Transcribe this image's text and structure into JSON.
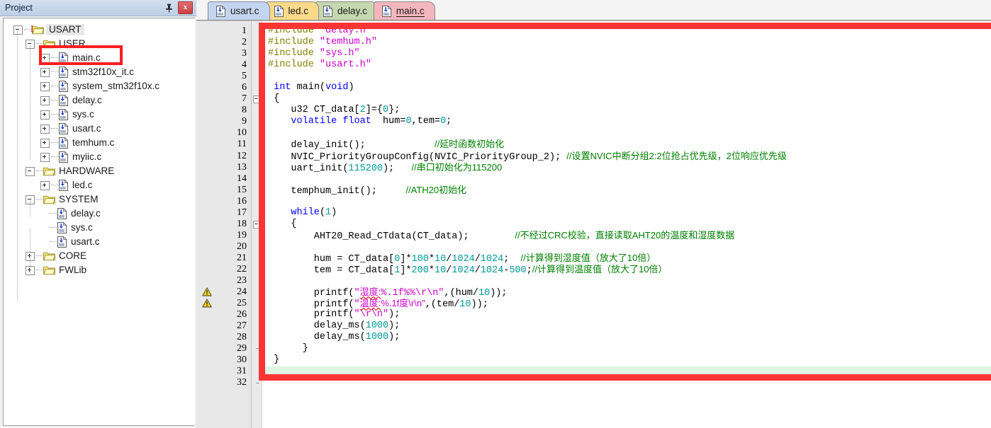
{
  "project_panel": {
    "title": "Project",
    "pin_icon": "pin-icon",
    "close_label": "x",
    "tree": [
      {
        "label": "USART",
        "depth": 0,
        "type": "project",
        "expander": "minus",
        "selected": true
      },
      {
        "label": "USER",
        "depth": 1,
        "type": "folder",
        "expander": "minus",
        "selected": false
      },
      {
        "label": "main.c",
        "depth": 2,
        "type": "cfile",
        "expander": "plus",
        "selected": false,
        "highlighted": true
      },
      {
        "label": "stm32f10x_it.c",
        "depth": 2,
        "type": "cfile",
        "expander": "plus",
        "selected": false
      },
      {
        "label": "system_stm32f10x.c",
        "depth": 2,
        "type": "cfile",
        "expander": "plus",
        "selected": false
      },
      {
        "label": "delay.c",
        "depth": 2,
        "type": "cfile",
        "expander": "plus",
        "selected": false
      },
      {
        "label": "sys.c",
        "depth": 2,
        "type": "cfile",
        "expander": "plus",
        "selected": false
      },
      {
        "label": "usart.c",
        "depth": 2,
        "type": "cfile",
        "expander": "plus",
        "selected": false
      },
      {
        "label": "temhum.c",
        "depth": 2,
        "type": "cfile",
        "expander": "plus",
        "selected": false
      },
      {
        "label": "myiic.c",
        "depth": 2,
        "type": "cfile",
        "expander": "plus",
        "selected": false
      },
      {
        "label": "HARDWARE",
        "depth": 1,
        "type": "folder",
        "expander": "minus",
        "selected": false
      },
      {
        "label": "led.c",
        "depth": 2,
        "type": "cfile",
        "expander": "plus",
        "selected": false
      },
      {
        "label": "SYSTEM",
        "depth": 1,
        "type": "folder",
        "expander": "minus",
        "selected": false
      },
      {
        "label": "delay.c",
        "depth": 2,
        "type": "cfile",
        "expander": "none",
        "selected": false
      },
      {
        "label": "sys.c",
        "depth": 2,
        "type": "cfile",
        "expander": "none",
        "selected": false
      },
      {
        "label": "usart.c",
        "depth": 2,
        "type": "cfile",
        "expander": "none",
        "selected": false
      },
      {
        "label": "CORE",
        "depth": 1,
        "type": "folder",
        "expander": "plus",
        "selected": false
      },
      {
        "label": "FWLib",
        "depth": 1,
        "type": "folder",
        "expander": "plus",
        "selected": false
      }
    ]
  },
  "editor": {
    "tabs": [
      {
        "label": "usart.c",
        "color": "#c4d5ef",
        "active": false
      },
      {
        "label": "led.c",
        "color": "#fbd98a",
        "active": false
      },
      {
        "label": "delay.c",
        "color": "#c6d8b0",
        "active": false
      },
      {
        "label": "main.c",
        "color": "#f3b6bd",
        "active": true
      }
    ],
    "line_numbers": [
      1,
      2,
      3,
      4,
      5,
      6,
      7,
      8,
      9,
      10,
      11,
      12,
      13,
      14,
      15,
      16,
      17,
      18,
      19,
      20,
      21,
      22,
      23,
      24,
      25,
      26,
      27,
      28,
      29,
      30,
      31,
      32
    ],
    "warning_lines": [
      24,
      25
    ],
    "highlight_line": 31,
    "highlight_color": "#ddf7e3",
    "annotation_color": "#fb3434",
    "code_lines": [
      {
        "n": 1,
        "tokens": [
          {
            "t": "#include ",
            "c": "pp"
          },
          {
            "t": "\"delay.h\"",
            "c": "str"
          }
        ]
      },
      {
        "n": 2,
        "tokens": [
          {
            "t": "#include ",
            "c": "pp"
          },
          {
            "t": "\"temhum.h\"",
            "c": "str"
          }
        ]
      },
      {
        "n": 3,
        "tokens": [
          {
            "t": "#include ",
            "c": "pp"
          },
          {
            "t": "\"sys.h\"",
            "c": "str"
          }
        ]
      },
      {
        "n": 4,
        "tokens": [
          {
            "t": "#include ",
            "c": "pp"
          },
          {
            "t": "\"usart.h\"",
            "c": "str"
          }
        ]
      },
      {
        "n": 5,
        "tokens": []
      },
      {
        "n": 6,
        "tokens": [
          {
            "t": " ",
            "c": ""
          },
          {
            "t": "int",
            "c": "k"
          },
          {
            "t": " main(",
            "c": ""
          },
          {
            "t": "void",
            "c": "k"
          },
          {
            "t": ")",
            "c": ""
          }
        ]
      },
      {
        "n": 7,
        "tokens": [
          {
            "t": " {",
            "c": ""
          }
        ]
      },
      {
        "n": 8,
        "tokens": [
          {
            "t": "    u32 CT_data[",
            "c": ""
          },
          {
            "t": "2",
            "c": "num"
          },
          {
            "t": "]={",
            "c": ""
          },
          {
            "t": "0",
            "c": "num"
          },
          {
            "t": "};",
            "c": ""
          }
        ]
      },
      {
        "n": 9,
        "tokens": [
          {
            "t": "    ",
            "c": ""
          },
          {
            "t": "volatile float",
            "c": "k"
          },
          {
            "t": "  hum=",
            "c": ""
          },
          {
            "t": "0",
            "c": "num"
          },
          {
            "t": ",tem=",
            "c": ""
          },
          {
            "t": "0",
            "c": "num"
          },
          {
            "t": ";",
            "c": ""
          }
        ]
      },
      {
        "n": 10,
        "tokens": []
      },
      {
        "n": 11,
        "tokens": [
          {
            "t": "    delay_init();            ",
            "c": ""
          },
          {
            "t": "//延时函数初始化",
            "c": "cm"
          }
        ]
      },
      {
        "n": 12,
        "tokens": [
          {
            "t": "    NVIC_PriorityGroupConfig(NVIC_PriorityGroup_2); ",
            "c": ""
          },
          {
            "t": "//设置NVIC中断分组2:2位抢占优先级，2位响应优先级",
            "c": "cm"
          }
        ]
      },
      {
        "n": 13,
        "tokens": [
          {
            "t": "    uart_init(",
            "c": ""
          },
          {
            "t": "115200",
            "c": "num"
          },
          {
            "t": ");   ",
            "c": ""
          },
          {
            "t": "//串口初始化为115200",
            "c": "cm"
          }
        ]
      },
      {
        "n": 14,
        "tokens": []
      },
      {
        "n": 15,
        "tokens": [
          {
            "t": "    temphum_init();     ",
            "c": ""
          },
          {
            "t": "//ATH20初始化",
            "c": "cm"
          }
        ]
      },
      {
        "n": 16,
        "tokens": []
      },
      {
        "n": 17,
        "tokens": [
          {
            "t": "    ",
            "c": ""
          },
          {
            "t": "while",
            "c": "k"
          },
          {
            "t": "(",
            "c": ""
          },
          {
            "t": "1",
            "c": "num"
          },
          {
            "t": ")",
            "c": ""
          }
        ]
      },
      {
        "n": 18,
        "tokens": [
          {
            "t": "    {",
            "c": ""
          }
        ]
      },
      {
        "n": 19,
        "tokens": [
          {
            "t": "        AHT20_Read_CTdata(CT_data);        ",
            "c": ""
          },
          {
            "t": "//不经过CRC校验，直接读取AHT20的温度和湿度数据",
            "c": "cm"
          }
        ]
      },
      {
        "n": 20,
        "tokens": []
      },
      {
        "n": 21,
        "tokens": [
          {
            "t": "        hum = CT_data[",
            "c": ""
          },
          {
            "t": "0",
            "c": "num"
          },
          {
            "t": "]*",
            "c": ""
          },
          {
            "t": "100",
            "c": "num"
          },
          {
            "t": "*",
            "c": ""
          },
          {
            "t": "10",
            "c": "num"
          },
          {
            "t": "/",
            "c": ""
          },
          {
            "t": "1024",
            "c": "num"
          },
          {
            "t": "/",
            "c": ""
          },
          {
            "t": "1024",
            "c": "num"
          },
          {
            "t": ";  ",
            "c": ""
          },
          {
            "t": "//计算得到湿度值（放大了10倍）",
            "c": "cm"
          }
        ]
      },
      {
        "n": 22,
        "tokens": [
          {
            "t": "        tem = CT_data[",
            "c": ""
          },
          {
            "t": "1",
            "c": "num"
          },
          {
            "t": "]*",
            "c": ""
          },
          {
            "t": "200",
            "c": "num"
          },
          {
            "t": "*",
            "c": ""
          },
          {
            "t": "10",
            "c": "num"
          },
          {
            "t": "/",
            "c": ""
          },
          {
            "t": "1024",
            "c": "num"
          },
          {
            "t": "/",
            "c": ""
          },
          {
            "t": "1024",
            "c": "num"
          },
          {
            "t": "-",
            "c": ""
          },
          {
            "t": "500",
            "c": "num"
          },
          {
            "t": ";",
            "c": ""
          },
          {
            "t": "//计算得到温度值（放大了10倍）",
            "c": "cm"
          }
        ]
      },
      {
        "n": 23,
        "tokens": []
      },
      {
        "n": 24,
        "tokens": [
          {
            "t": "        printf(",
            "c": ""
          },
          {
            "t": "\"",
            "c": "str"
          },
          {
            "t": "湿度:",
            "c": "str sq"
          },
          {
            "t": "%.1f%%\\r\\n\"",
            "c": "str"
          },
          {
            "t": ",(hum/",
            "c": ""
          },
          {
            "t": "10",
            "c": "num"
          },
          {
            "t": "));",
            "c": ""
          }
        ]
      },
      {
        "n": 25,
        "tokens": [
          {
            "t": "        printf(",
            "c": ""
          },
          {
            "t": "\"",
            "c": "str"
          },
          {
            "t": "温度:",
            "c": "str sq"
          },
          {
            "t": "%.1f度\\r\\n\"",
            "c": "str"
          },
          {
            "t": ",(tem/",
            "c": ""
          },
          {
            "t": "10",
            "c": "num"
          },
          {
            "t": "));",
            "c": ""
          }
        ]
      },
      {
        "n": 26,
        "tokens": [
          {
            "t": "        printf(",
            "c": ""
          },
          {
            "t": "\"\\r\\n\"",
            "c": "str"
          },
          {
            "t": ");",
            "c": ""
          }
        ]
      },
      {
        "n": 27,
        "tokens": [
          {
            "t": "        delay_ms(",
            "c": ""
          },
          {
            "t": "1000",
            "c": "num"
          },
          {
            "t": ");",
            "c": ""
          }
        ]
      },
      {
        "n": 28,
        "tokens": [
          {
            "t": "        delay_ms(",
            "c": ""
          },
          {
            "t": "1000",
            "c": "num"
          },
          {
            "t": ");",
            "c": ""
          }
        ]
      },
      {
        "n": 29,
        "tokens": [
          {
            "t": "      }",
            "c": ""
          }
        ]
      },
      {
        "n": 30,
        "tokens": [
          {
            "t": " }",
            "c": ""
          }
        ]
      },
      {
        "n": 31,
        "tokens": []
      },
      {
        "n": 32,
        "tokens": []
      }
    ]
  }
}
